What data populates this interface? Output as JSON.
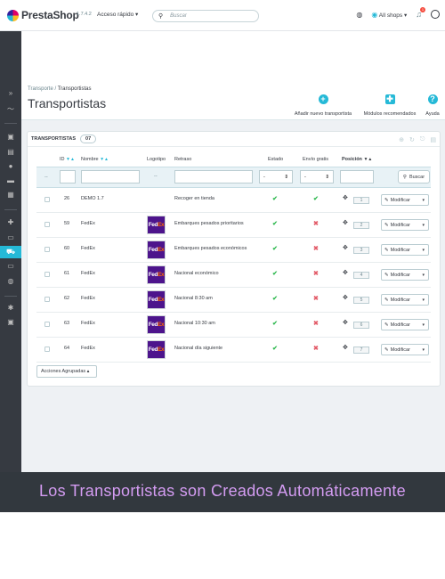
{
  "topbar": {
    "brand": "PrestaShop",
    "version": "1.7.4.2",
    "quick_access": "Acceso rápido ▾",
    "search_placeholder": "Buscar",
    "shop_selector": "All shops ▾",
    "notifications_count": "1"
  },
  "header": {
    "breadcrumb_parent": "Transporte",
    "breadcrumb_sep": "/",
    "breadcrumb_current": "Transportistas",
    "title": "Transportistas",
    "toolbar": {
      "add_label": "Añadir nuevo transportista",
      "modules_label": "Módulos recomendados",
      "help_label": "Ayuda"
    }
  },
  "panel": {
    "title": "TRANSPORTISTAS",
    "count": "07",
    "columns": {
      "id": "ID",
      "name": "Nombre",
      "logo": "Logotipo",
      "delay": "Retraso",
      "status": "Estado",
      "free": "Envío gratis",
      "position": "Posición"
    },
    "filter": {
      "dashes": "--",
      "logo_dashes": "--",
      "select_status": "-",
      "select_free": "-",
      "search_button": "Buscar"
    },
    "rows": [
      {
        "id": "26",
        "name": "DEMO 1.7",
        "logo": "",
        "delay": "Recoger en tienda",
        "status": "✔",
        "free": "✔",
        "position": "1",
        "action": "Modificar"
      },
      {
        "id": "59",
        "name": "FedEx",
        "logo": "FedEx",
        "delay": "Embarques pesados prioritarios",
        "status": "✔",
        "free": "✖",
        "position": "2",
        "action": "Modificar"
      },
      {
        "id": "60",
        "name": "FedEx",
        "logo": "FedEx",
        "delay": "Embarques pesados económicos",
        "status": "✔",
        "free": "✖",
        "position": "3",
        "action": "Modificar"
      },
      {
        "id": "61",
        "name": "FedEx",
        "logo": "FedEx",
        "delay": "Nacional económico",
        "status": "✔",
        "free": "✖",
        "position": "4",
        "action": "Modificar"
      },
      {
        "id": "62",
        "name": "FedEx",
        "logo": "FedEx",
        "delay": "Nacional 8:30 am",
        "status": "✔",
        "free": "✖",
        "position": "5",
        "action": "Modificar"
      },
      {
        "id": "63",
        "name": "FedEx",
        "logo": "FedEx",
        "delay": "Nacional 10:30 am",
        "status": "✔",
        "free": "✖",
        "position": "6",
        "action": "Modificar"
      },
      {
        "id": "64",
        "name": "FedEx",
        "logo": "FedEx",
        "delay": "Nacional día siguiente",
        "status": "✔",
        "free": "✖",
        "position": "7",
        "action": "Modificar"
      }
    ],
    "bulk_actions": "Acciones Agrupadas ▴"
  },
  "banner": {
    "text": "Los Transportistas son Creados Automáticamente"
  },
  "colors": {
    "accent": "#25b9d7",
    "sidebar": "#363a41",
    "ok": "#2eb84f",
    "no": "#e35d6a",
    "banner_text": "#d49cf2",
    "fedex_purple": "#4d148c",
    "fedex_orange": "#ff6600"
  },
  "icons": {
    "search": "search-icon",
    "add": "plus-circle-icon",
    "modules": "puzzle-icon",
    "help": "question-circle-icon",
    "edit": "pencil-icon",
    "move": "drag-handle-icon"
  }
}
